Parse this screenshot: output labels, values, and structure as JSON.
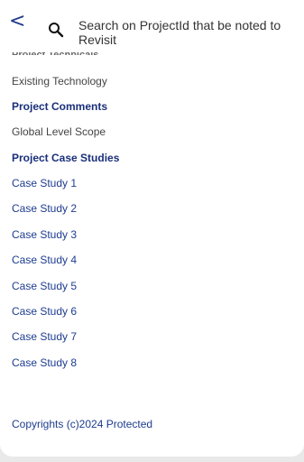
{
  "header": {
    "back_glyph": "<",
    "search_icon": "search-icon",
    "search_text": "Search on ProjectId that be noted to Revisit"
  },
  "content": {
    "partial_heading": "Project Technicals",
    "existing_technology": "Existing Technology",
    "project_comments_heading": "Project Comments",
    "global_scope": "Global Level Scope",
    "case_studies_heading": "Project Case Studies",
    "case_studies": [
      "Case Study 1",
      "Case Study 2",
      "Case Study 3",
      "Case Study 4",
      "Case Study 5",
      "Case Study 6",
      "Case Study 7",
      "Case Study 8"
    ]
  },
  "footer": {
    "copyright": "Copyrights (c)2024 Protected"
  },
  "colors": {
    "accent": "#1d3c8f",
    "heading": "#1a2f7a"
  }
}
